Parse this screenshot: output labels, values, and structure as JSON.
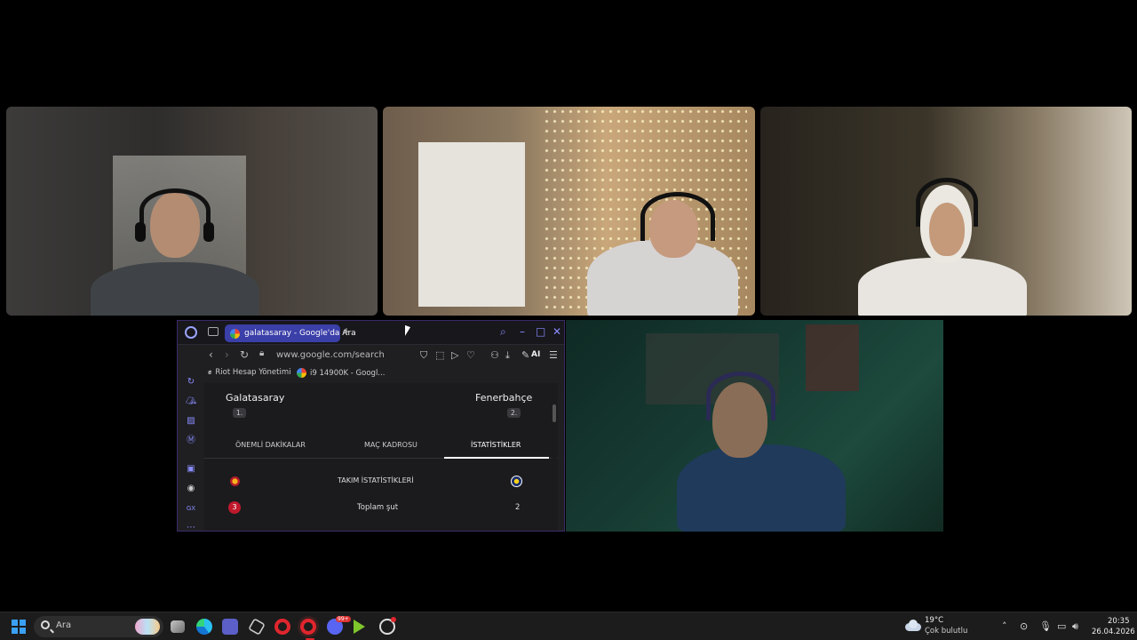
{
  "browser": {
    "tab_title": "galatasaray - Google'da Ara",
    "new_tab": "+",
    "url": "www.google.com/search",
    "ai_label": "AI",
    "bookmarks": [
      {
        "label": "Riot Hesap Yönetimi"
      },
      {
        "label": "i9 14900K - Googl..."
      }
    ],
    "window_controls": {
      "search": "⌕",
      "minimize": "–",
      "maximize": "□",
      "close": "✕"
    }
  },
  "match": {
    "home_team": "Galatasaray",
    "home_rank": "1.",
    "away_team": "Fenerbahçe",
    "away_rank": "2.",
    "tabs": [
      {
        "label": "ÖNEMLİ DAKİKALAR",
        "active": false
      },
      {
        "label": "MAÇ KADROSU",
        "active": false
      },
      {
        "label": "İSTATİSTİKLER",
        "active": true
      }
    ],
    "stats_header": "TAKIM İSTATİSTİKLERİ",
    "stats": [
      {
        "label": "Toplam şut",
        "home": "3",
        "away": "2"
      }
    ]
  },
  "taskbar": {
    "search_placeholder": "Ara",
    "weather_temp": "19°C",
    "weather_desc": "Çok bulutlu",
    "time": "20:35",
    "date": "26.04.2026",
    "discord_badge": "99+"
  },
  "colors": {
    "accent": "#3b3fa8",
    "opera_red": "#e0262d",
    "windows_blue": "#3aa0f5",
    "stat_red": "#c0192c"
  }
}
